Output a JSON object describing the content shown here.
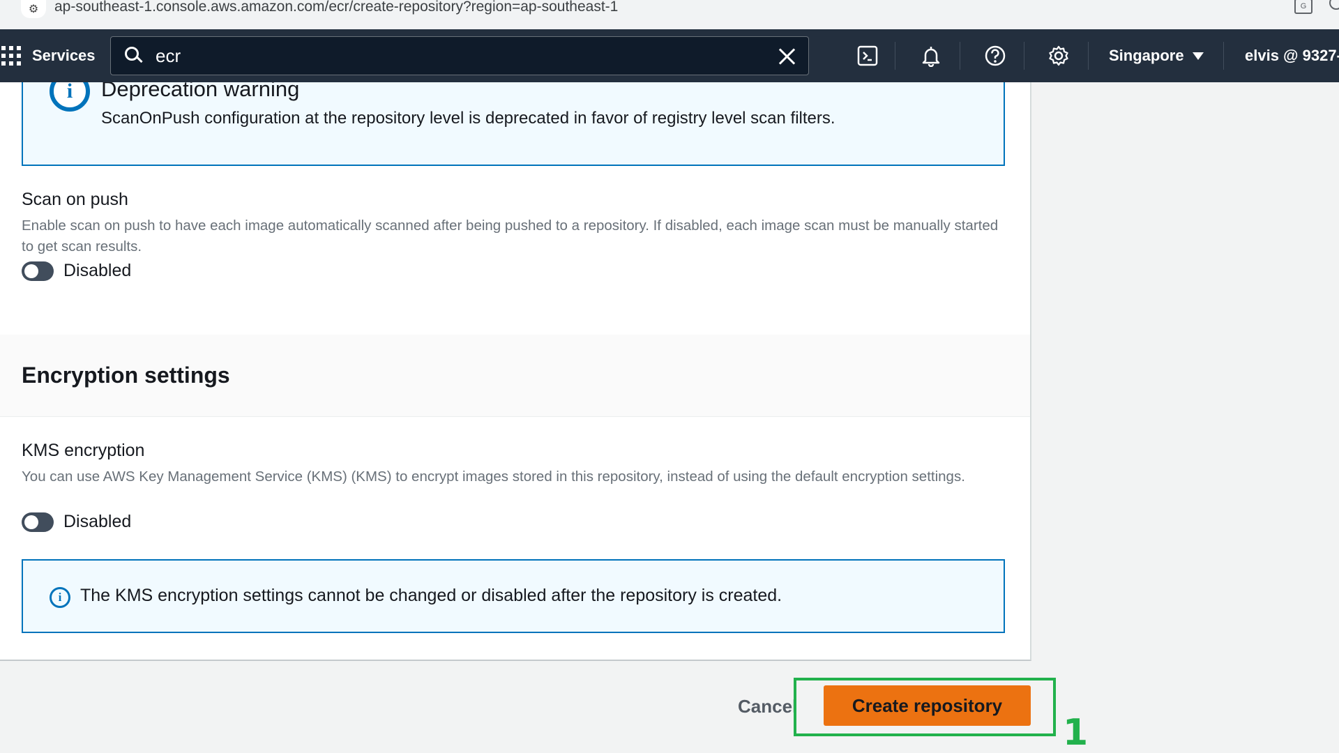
{
  "browser": {
    "url": "ap-southeast-1.console.aws.amazon.com/ecr/create-repository?region=ap-southeast-1"
  },
  "topnav": {
    "services_label": "Services",
    "search_value": "ecr",
    "region_label": "Singapore",
    "account_label": "elvis @ 9327-"
  },
  "deprecation_alert": {
    "title": "Deprecation warning",
    "text": "ScanOnPush configuration at the repository level is deprecated in favor of registry level scan filters."
  },
  "scan_on_push": {
    "label": "Scan on push",
    "description": "Enable scan on push to have each image automatically scanned after being pushed to a repository. If disabled, each image scan must be manually started to get scan results.",
    "toggle_label": "Disabled"
  },
  "encryption": {
    "section_title": "Encryption settings",
    "kms_label": "KMS encryption",
    "kms_description": "You can use AWS Key Management Service (KMS) (KMS) to encrypt images stored in this repository, instead of using the default encryption settings.",
    "toggle_label": "Disabled",
    "info_text": "The KMS encryption settings cannot be changed or disabled after the repository is created."
  },
  "actions": {
    "cancel_label": "Cancel",
    "create_label": "Create repository"
  },
  "annotation": {
    "number": "1"
  },
  "colors": {
    "nav_bg": "#232f3e",
    "primary_button": "#ec7211",
    "info_blue": "#0073bb",
    "highlight_green": "#22b14c"
  }
}
